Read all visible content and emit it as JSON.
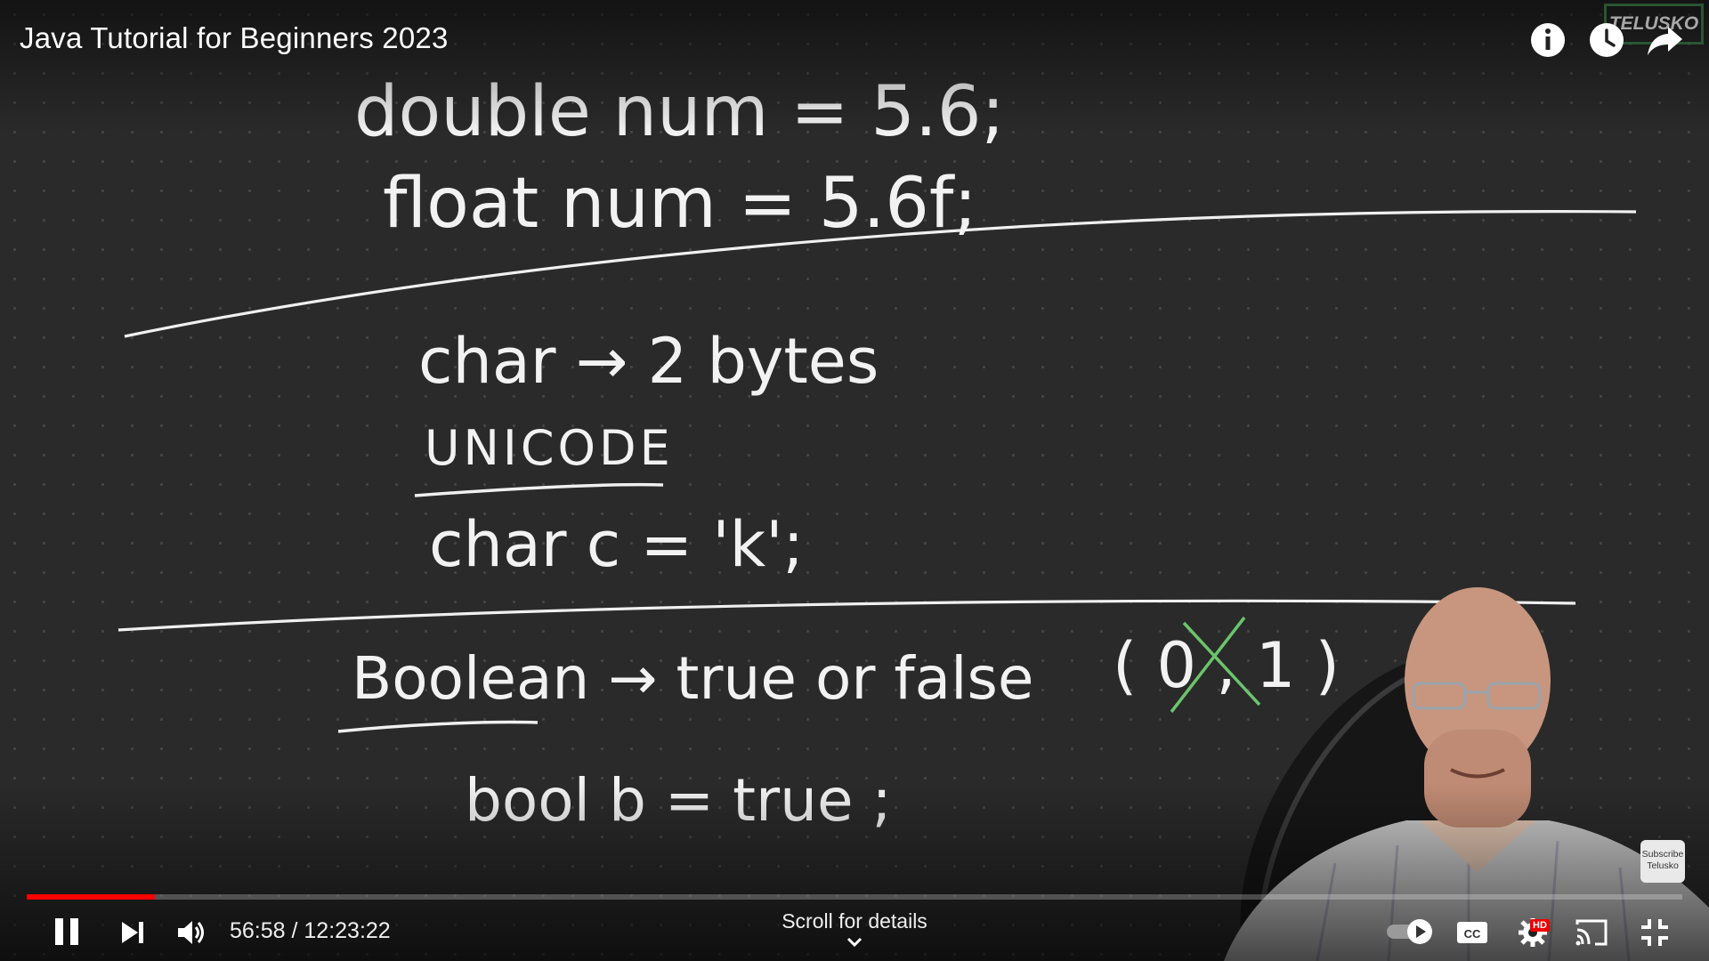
{
  "video": {
    "title": "Java Tutorial for Beginners 2023",
    "watermark": "TELUSKO",
    "subscribe_badge": "Subscribe Telusko",
    "progress": 0.0775
  },
  "whiteboard": {
    "lines": [
      "double    num = 5.6;",
      "float    num = 5.6f;",
      "char  →  2 bytes",
      "UNICODE",
      "char  c = 'k';",
      "Boolean  →  true or false",
      "( 0 , 1 )",
      "bool   b = true ;"
    ]
  },
  "top_actions": {
    "info_icon": "info-icon",
    "watch_later_icon": "clock-icon",
    "share_icon": "share-icon"
  },
  "controls": {
    "current_time": "56:58",
    "duration": "12:23:22",
    "time_display": "56:58 / 12:23:22",
    "scroll_hint": "Scroll for details",
    "hd_badge": "HD"
  },
  "colors": {
    "progress": "#ff0000",
    "chalk": "#f2f2f2",
    "cross_out": "#6cc46c"
  }
}
